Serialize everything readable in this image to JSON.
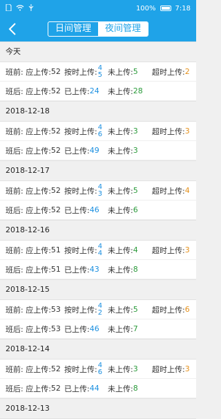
{
  "status_bar": {
    "battery_text": "100%",
    "time": "7:18"
  },
  "header": {
    "tabs": [
      "日间管理",
      "夜间管理"
    ],
    "active_tab": 1
  },
  "labels": {
    "before": "班前: 应上传: ",
    "after": "班后: 应上传: ",
    "ontime": "按时上传: ",
    "not_uploaded": "未上传: ",
    "overtime": "超时上传: ",
    "uploaded": "已上传: "
  },
  "groups": [
    {
      "date": "今天",
      "before": {
        "should": "52",
        "ontime_top": "4",
        "ontime_bottom": "5",
        "not_uploaded": "5",
        "overtime": "2"
      },
      "after": {
        "should": "52",
        "uploaded": "24",
        "not_uploaded": "28"
      }
    },
    {
      "date": "2018-12-18",
      "before": {
        "should": "52",
        "ontime_top": "4",
        "ontime_bottom": "6",
        "not_uploaded": "3",
        "overtime": "3"
      },
      "after": {
        "should": "52",
        "uploaded": "49",
        "not_uploaded": "3"
      }
    },
    {
      "date": "2018-12-17",
      "before": {
        "should": "52",
        "ontime_top": "4",
        "ontime_bottom": "3",
        "not_uploaded": "5",
        "overtime": "4"
      },
      "after": {
        "should": "52",
        "uploaded": "46",
        "not_uploaded": "6"
      }
    },
    {
      "date": "2018-12-16",
      "before": {
        "should": "51",
        "ontime_top": "4",
        "ontime_bottom": "4",
        "not_uploaded": "4",
        "overtime": "3"
      },
      "after": {
        "should": "51",
        "uploaded": "43",
        "not_uploaded": "8"
      }
    },
    {
      "date": "2018-12-15",
      "before": {
        "should": "53",
        "ontime_top": "4",
        "ontime_bottom": "2",
        "not_uploaded": "5",
        "overtime": "6"
      },
      "after": {
        "should": "53",
        "uploaded": "46",
        "not_uploaded": "7"
      }
    },
    {
      "date": "2018-12-14",
      "before": {
        "should": "52",
        "ontime_top": "4",
        "ontime_bottom": "6",
        "not_uploaded": "3",
        "overtime": "3"
      },
      "after": {
        "should": "52",
        "uploaded": "44",
        "not_uploaded": "8"
      }
    }
  ],
  "last_date": "2018-12-13",
  "colors": {
    "accent": "#1fa3e8",
    "blue": "#1a8fe0",
    "green": "#2a9a3a",
    "orange": "#e5901a"
  }
}
